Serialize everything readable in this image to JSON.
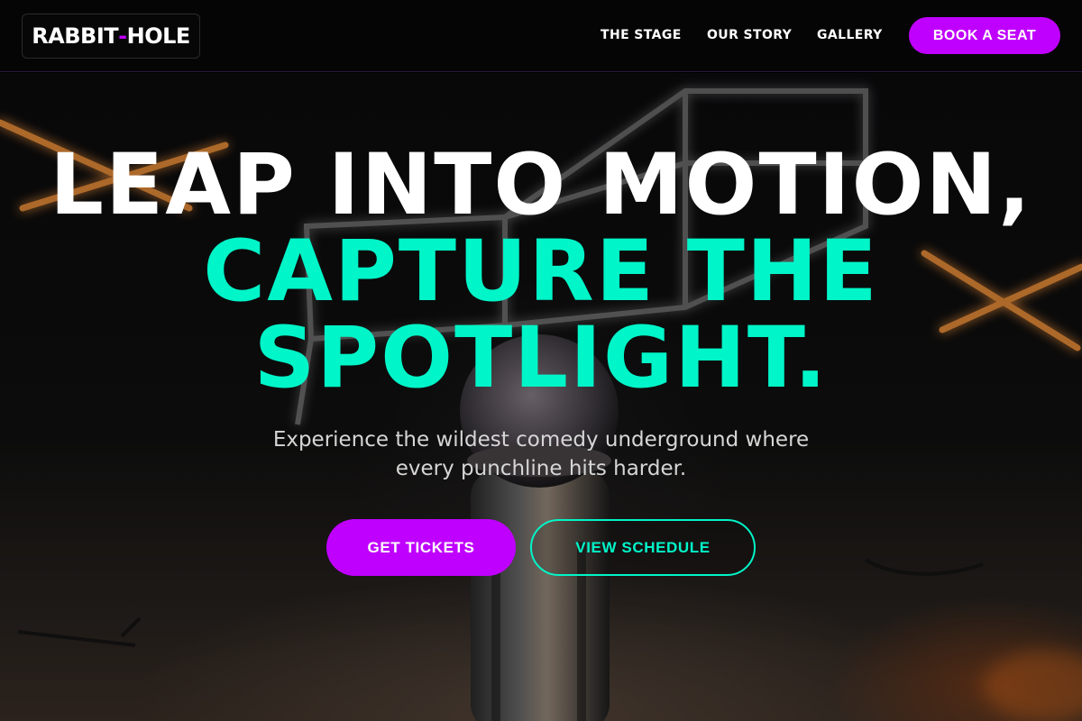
{
  "header": {
    "logo": {
      "part1": "RABBIT",
      "dash": "-",
      "part2": "HOLE"
    },
    "nav": [
      {
        "label": "THE STAGE"
      },
      {
        "label": "OUR STORY"
      },
      {
        "label": "GALLERY"
      }
    ],
    "cta_label": "BOOK A SEAT"
  },
  "hero": {
    "headline_line1": "LEAP INTO MOTION,",
    "headline_line2": "CAPTURE THE",
    "headline_line3": "SPOTLIGHT.",
    "subtitle": "Experience the wildest comedy underground where every punchline hits harder.",
    "primary_button": "GET TICKETS",
    "secondary_button": "VIEW SCHEDULE",
    "background_icon": "microphone-neon-stage-photo"
  },
  "colors": {
    "accent_purple": "#c000ff",
    "accent_teal": "#00f5c8",
    "background": "#050505",
    "text_white": "#ffffff",
    "neon_orange": "#ff9a3c"
  }
}
